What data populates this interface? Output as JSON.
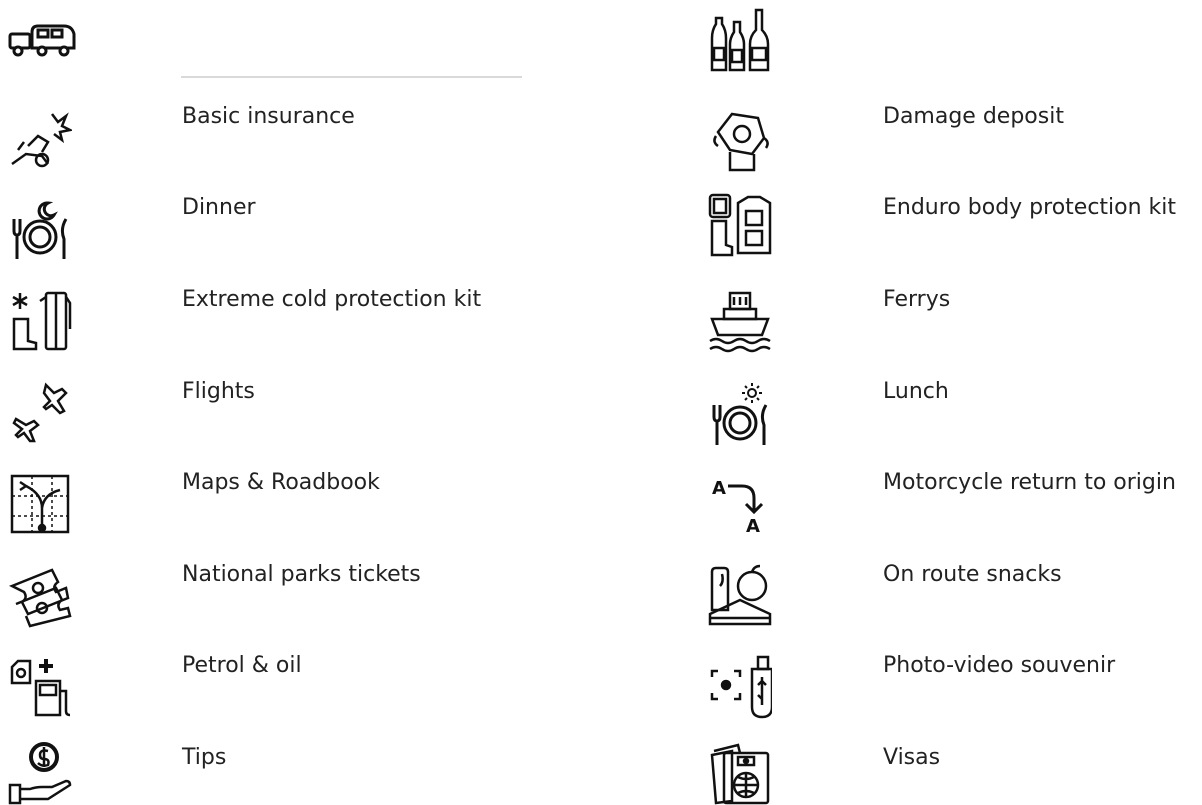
{
  "header": {
    "left_icon": "caravan-car-icon",
    "right_icon": "drinks-bottles-icon"
  },
  "left_items": [
    {
      "label": "Basic insurance",
      "icon": "crash-insurance-icon"
    },
    {
      "label": "Dinner",
      "icon": "dinner-plate-moon-icon"
    },
    {
      "label": "Extreme cold protection kit",
      "icon": "cold-protection-kit-icon"
    },
    {
      "label": "Flights",
      "icon": "flights-icon"
    },
    {
      "label": "Maps & Roadbook",
      "icon": "map-roadbook-icon"
    },
    {
      "label": "National parks tickets",
      "icon": "park-tickets-icon"
    },
    {
      "label": "Petrol & oil",
      "icon": "fuel-pump-icon"
    },
    {
      "label": "Tips",
      "icon": "tip-coin-hand-icon"
    }
  ],
  "right_items": [
    {
      "label": "Damage deposit",
      "icon": "deposit-money-hand-icon"
    },
    {
      "label": "Enduro body protection kit",
      "icon": "enduro-protection-kit-icon"
    },
    {
      "label": "Ferrys",
      "icon": "ferry-boat-icon"
    },
    {
      "label": "Lunch",
      "icon": "lunch-plate-sun-icon"
    },
    {
      "label": "Motorcycle return to origin",
      "icon": "return-to-origin-icon"
    },
    {
      "label": "On route snacks",
      "icon": "snacks-icon"
    },
    {
      "label": "Photo-video souvenir",
      "icon": "photo-video-usb-icon"
    },
    {
      "label": "Visas",
      "icon": "passport-visa-icon"
    }
  ]
}
